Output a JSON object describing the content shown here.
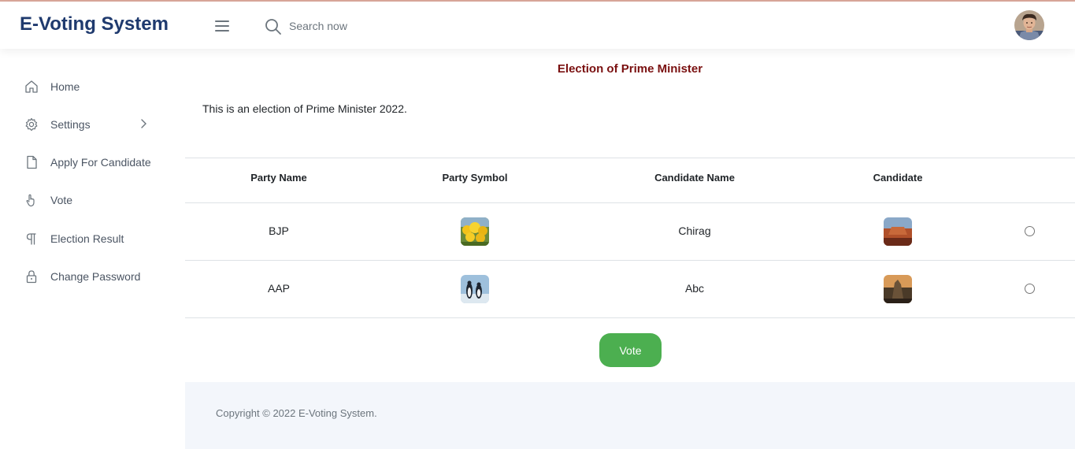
{
  "header": {
    "brand": "E-Voting System",
    "search_placeholder": "Search now"
  },
  "sidebar": {
    "items": [
      {
        "label": "Home",
        "icon": "home-icon"
      },
      {
        "label": "Settings",
        "icon": "gear-icon"
      },
      {
        "label": "Apply For Candidate",
        "icon": "file-icon"
      },
      {
        "label": "Vote",
        "icon": "hand-pointer-icon"
      },
      {
        "label": "Election Result",
        "icon": "pilcrow-icon"
      },
      {
        "label": "Change Password",
        "icon": "lock-icon"
      }
    ]
  },
  "election": {
    "title": "Election of Prime Minister",
    "description": "This is an election of Prime Minister 2022."
  },
  "table": {
    "headers": [
      "Party Name",
      "Party Symbol",
      "Candidate Name",
      "Candidate"
    ],
    "rows": [
      {
        "party": "BJP",
        "candidate": "Chirag"
      },
      {
        "party": "AAP",
        "candidate": "Abc"
      }
    ]
  },
  "vote_button": "Vote",
  "footer": {
    "copyright": "Copyright © 2022 E-Voting System."
  },
  "colors": {
    "brand": "#1f3a6e",
    "title": "#7a1010",
    "vote_button": "#4caf50",
    "footer_bg": "#f3f6fb"
  }
}
